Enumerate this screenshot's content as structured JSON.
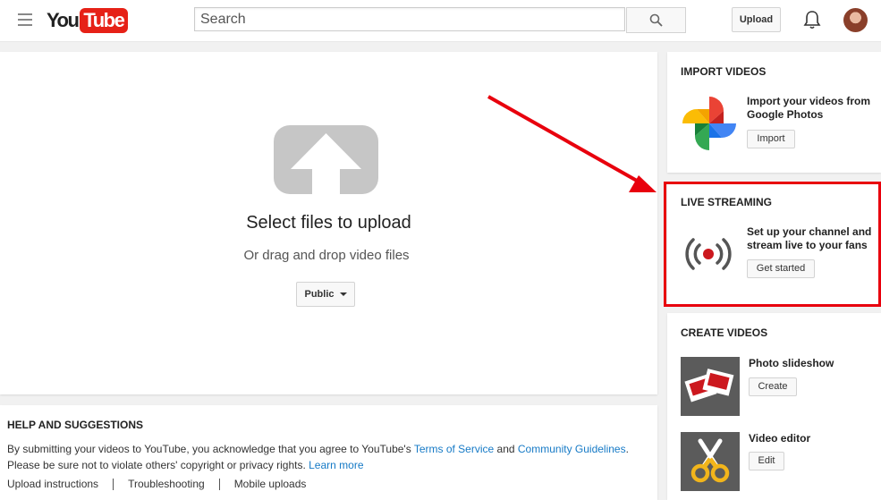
{
  "header": {
    "logo_you": "You",
    "logo_tube": "Tube",
    "search_placeholder": "Search",
    "upload_label": "Upload"
  },
  "upload": {
    "title": "Select files to upload",
    "subtitle": "Or drag and drop video files",
    "privacy_label": "Public"
  },
  "help": {
    "title": "HELP AND SUGGESTIONS",
    "line1_prefix": "By submitting your videos to YouTube, you acknowledge that you agree to YouTube's ",
    "terms_link": "Terms of Service",
    "and_text": " and ",
    "guidelines_link": "Community Guidelines",
    "line1_suffix": ".",
    "line2_prefix": "Please be sure not to violate others' copyright or privacy rights. ",
    "learn_more_link": "Learn more",
    "links": [
      "Upload instructions",
      "Troubleshooting",
      "Mobile uploads"
    ]
  },
  "import_card": {
    "title": "IMPORT VIDEOS",
    "text": "Import your videos from Google Photos",
    "button": "Import"
  },
  "live_card": {
    "title": "LIVE STREAMING",
    "text": "Set up your channel and stream live to your fans",
    "button": "Get started"
  },
  "create_card": {
    "title": "CREATE VIDEOS",
    "items": [
      {
        "label": "Photo slideshow",
        "button": "Create"
      },
      {
        "label": "Video editor",
        "button": "Edit"
      }
    ]
  },
  "colors": {
    "brand_red": "#e62117",
    "link_blue": "#167ac6",
    "highlight_red": "#e8000d"
  }
}
